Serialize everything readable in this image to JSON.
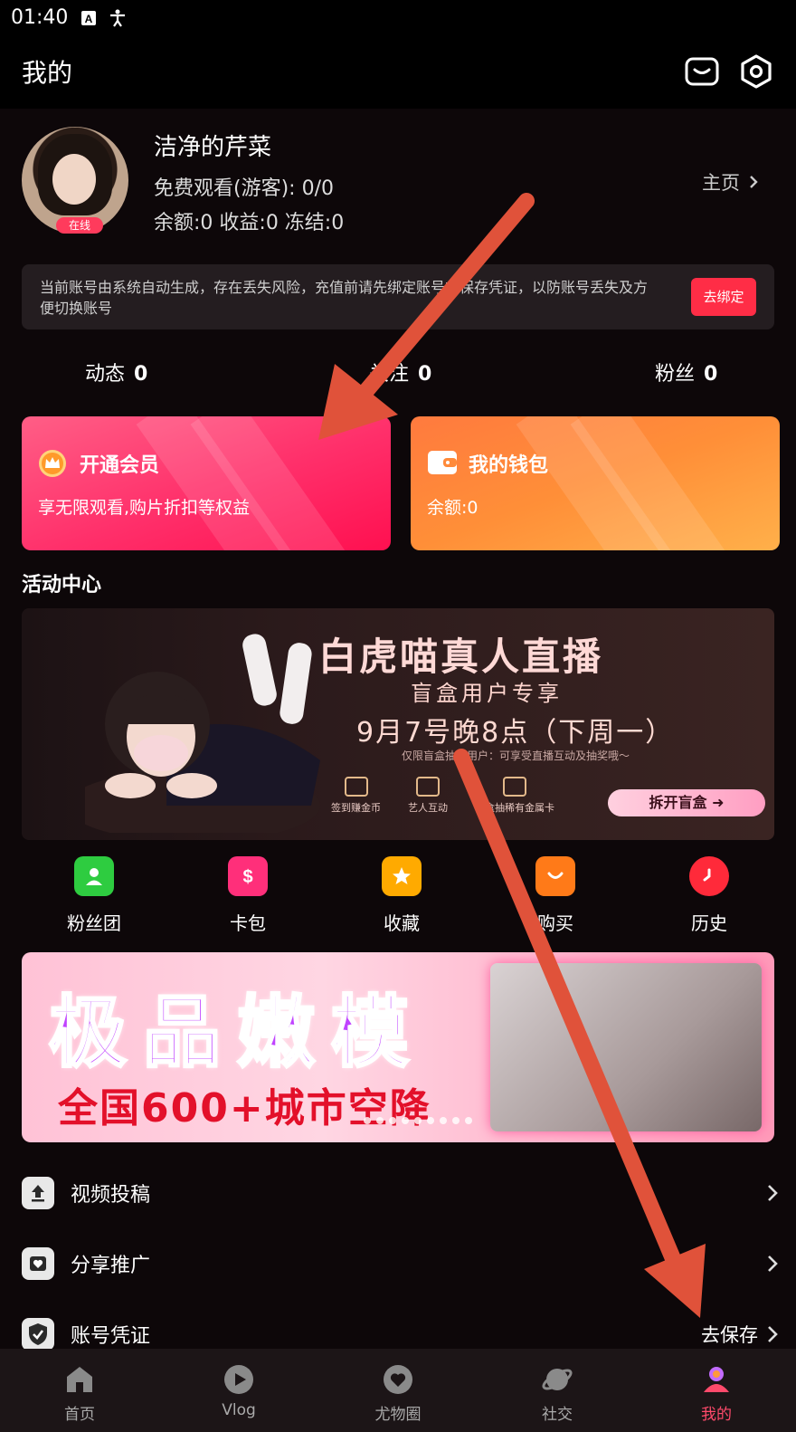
{
  "status_bar": {
    "time": "01:40"
  },
  "header": {
    "title": "我的"
  },
  "profile": {
    "username": "洁净的芹菜",
    "free_watch": "免费观看(游客): 0/0",
    "balance_line": "余额:0 收益:0 冻结:0",
    "online_badge": "在线",
    "home_link": "主页"
  },
  "notice": {
    "text": "当前账号由系统自动生成，存在丢失风险，充值前请先绑定账号或保存凭证，以防账号丢失及方便切换账号",
    "button": "去绑定"
  },
  "stats": [
    {
      "label": "动态",
      "value": "0"
    },
    {
      "label": "关注",
      "value": "0"
    },
    {
      "label": "粉丝",
      "value": "0"
    }
  ],
  "cards": {
    "vip": {
      "title": "开通会员",
      "subtitle": "享无限观看,购片折扣等权益"
    },
    "wallet": {
      "title": "我的钱包",
      "subtitle": "余额:0"
    }
  },
  "section_title": "活动中心",
  "banner1": {
    "main": "白虎喵真人直播",
    "sub": "盲盒用户专享",
    "date": "9月7号晚8点（下周一）",
    "small": "仅限盲盒抽奖用户：可享受直播互动及抽奖哦～",
    "features": [
      "签到赚金币",
      "艺人互动",
      "盲盒抽稀有金属卡"
    ],
    "button": "拆开盲盒"
  },
  "quick_actions": [
    {
      "label": "粉丝团",
      "color": "#2ecc40",
      "icon": "user-icon"
    },
    {
      "label": "卡包",
      "color": "#ff2f7a",
      "icon": "ticket-icon"
    },
    {
      "label": "收藏",
      "color": "#ffaa00",
      "icon": "star-icon"
    },
    {
      "label": "购买",
      "color": "#ff7a18",
      "icon": "bag-icon"
    },
    {
      "label": "历史",
      "color": "#ff2a3a",
      "icon": "clock-icon"
    }
  ],
  "banner2": {
    "title": "极品嫩模",
    "sub": "全国600+城市空降"
  },
  "menu": [
    {
      "label": "视频投稿",
      "right": ""
    },
    {
      "label": "分享推广",
      "right": ""
    },
    {
      "label": "账号凭证",
      "right": "去保存"
    }
  ],
  "tabs": [
    {
      "label": "首页",
      "icon": "home-icon"
    },
    {
      "label": "Vlog",
      "icon": "play-icon"
    },
    {
      "label": "尤物圈",
      "icon": "heart-bubble-icon"
    },
    {
      "label": "社交",
      "icon": "planet-icon"
    },
    {
      "label": "我的",
      "icon": "profile-icon"
    }
  ],
  "colors": {
    "accent": "#ff2d46",
    "active_tab": "#ff4a6b",
    "arrow": "#e0523a"
  }
}
